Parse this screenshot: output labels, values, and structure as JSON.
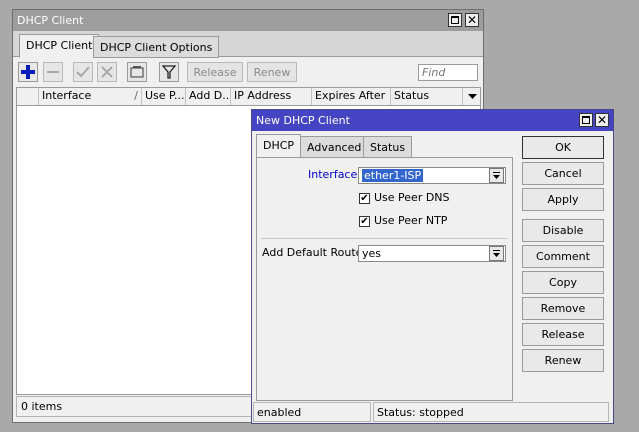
{
  "dhcp_client_window": {
    "title": "DHCP Client",
    "tabs": [
      "DHCP Client",
      "DHCP Client Options"
    ],
    "toolbar": {
      "icons": [
        "plus-icon",
        "minus-icon",
        "check-icon",
        "x-icon",
        "comment-icon",
        "filter-icon"
      ],
      "release_label": "Release",
      "renew_label": "Renew",
      "find_placeholder": "Find"
    },
    "table": {
      "columns": [
        "Interface",
        "Use P...",
        "Add D...",
        "IP Address",
        "Expires After",
        "Status"
      ],
      "rows": []
    },
    "status_bar": "0 items"
  },
  "new_dhcp_client_dialog": {
    "title": "New DHCP Client",
    "tabs": [
      "DHCP",
      "Advanced",
      "Status"
    ],
    "interface_label": "Interface:",
    "interface_value": "ether1-ISP",
    "use_peer_dns_label": "Use Peer DNS",
    "use_peer_dns_checked": true,
    "use_peer_ntp_label": "Use Peer NTP",
    "use_peer_ntp_checked": true,
    "add_default_route_label": "Add Default Route:",
    "add_default_route_value": "yes",
    "buttons": {
      "ok": "OK",
      "cancel": "Cancel",
      "apply": "Apply",
      "disable": "Disable",
      "comment": "Comment",
      "copy": "Copy",
      "remove": "Remove",
      "release": "Release",
      "renew": "Renew"
    },
    "status_bar": {
      "left": "enabled",
      "right": "Status: stopped"
    }
  },
  "colors": {
    "inactive_title": "#9d9d9d",
    "active_title": "#4545c3",
    "window_bg": "#f0f0f0",
    "desktop_bg": "#a9a9a9",
    "label_blue": "#0000c8",
    "selection": "#3366cc"
  }
}
